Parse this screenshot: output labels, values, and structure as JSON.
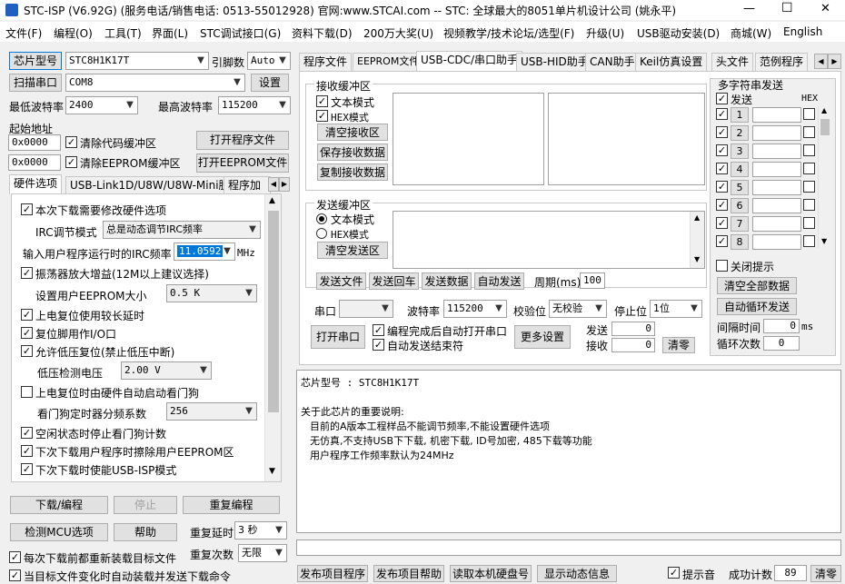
{
  "window": {
    "title": "STC-ISP (V6.92G) (服务电话/销售电话: 0513-55012928) 官网:www.STCAI.com  -- STC: 全球最大的8051单片机设计公司 (姚永平)"
  },
  "titlebar": {
    "minimize": "—",
    "maximize": "☐",
    "close": "✕"
  },
  "menu": [
    "文件(F)",
    "编程(O)",
    "工具(T)",
    "界面(L)",
    "STC调试接口(G)",
    "资料下载(D)",
    "200万大奖(U)",
    "视频教学/技术论坛/选型(F)",
    "升级(U)",
    "USB驱动安装(D)",
    "商城(W)",
    "English"
  ],
  "left": {
    "chip_btn": "芯片型号",
    "chip_value": "STC8H1K17T",
    "pins_label": "引脚数",
    "pins_value": "Auto",
    "scan_btn": "扫描串口",
    "port_value": "COM8",
    "settings_btn": "设置",
    "min_baud_label": "最低波特率",
    "min_baud_value": "2400",
    "max_baud_label": "最高波特率",
    "max_baud_value": "115200",
    "start_addr_label": "起始地址",
    "addr1": "0x0000",
    "clear_code": "清除代码缓冲区",
    "open_prog": "打开程序文件",
    "addr2": "0x0000",
    "clear_eeprom": "清除EEPROM缓冲区",
    "open_eeprom": "打开EEPROM文件",
    "tabs": [
      "硬件选项",
      "USB-Link1D/U8W/U8W-Mini脱机",
      "程序加"
    ],
    "options": {
      "opt1": "本次下载需要修改硬件选项",
      "irc_mode_label": "IRC调节模式",
      "irc_mode_value": "总是动态调节IRC频率",
      "irc_freq_label": "输入用户程序运行时的IRC频率",
      "irc_freq_value": "11.0592",
      "irc_unit": "MHz",
      "opt2": "振荡器放大增益(12M以上建议选择)",
      "eeprom_size_label": "设置用户EEPROM大小",
      "eeprom_size_value": "0.5 K",
      "opt3": "上电复位使用较长延时",
      "opt4": "复位脚用作I/O口",
      "opt5": "允许低压复位(禁止低压中断)",
      "lvd_label": "低压检测电压",
      "lvd_value": "2.00 V",
      "opt6": "上电复位时由硬件自动启动看门狗",
      "wdt_label": "看门狗定时器分频系数",
      "wdt_value": "256",
      "opt7": "空闲状态时停止看门狗计数",
      "opt8": "下次下载用户程序时擦除用户EEPROM区",
      "opt9": "下次下载时使能USB-ISP模式"
    },
    "download_btn": "下载/编程",
    "stop_btn": "停止",
    "reprog_btn": "重复编程",
    "detect_btn": "检测MCU选项",
    "help_btn": "帮助",
    "repeat_delay_label": "重复延时",
    "repeat_delay_value": "3 秒",
    "reload_each": "每次下载前都重新装载目标文件",
    "repeat_count_label": "重复次数",
    "repeat_count_value": "无限",
    "auto_reload": "当目标文件变化时自动装载并发送下载命令"
  },
  "right": {
    "tabs": [
      "程序文件",
      "EEPROM文件",
      "USB-CDC/串口助手",
      "USB-HID助手",
      "CAN助手",
      "Keil仿真设置",
      "头文件",
      "范例程序"
    ],
    "recv_group": "接收缓冲区",
    "recv_text": "文本模式",
    "recv_hex": "HEX模式",
    "clear_recv": "清空接收区",
    "save_recv": "保存接收数据",
    "copy_recv": "复制接收数据",
    "send_group": "发送缓冲区",
    "send_text": "文本模式",
    "send_hex": "HEX模式",
    "clear_send": "清空发送区",
    "send_file": "发送文件",
    "send_back": "发送回车",
    "send_data": "发送数据",
    "auto_send": "自动发送",
    "period_label": "周期(ms)",
    "period_value": "100",
    "port_label": "串口",
    "baud_label": "波特率",
    "baud_value": "115200",
    "parity_label": "校验位",
    "parity_value": "无校验",
    "stop_label": "停止位",
    "stop_value": "1位",
    "open_port": "打开串口",
    "auto_open": "编程完成后自动打开串口",
    "auto_end": "自动发送结束符",
    "more_settings": "更多设置",
    "sent_label": "发送",
    "sent_value": "0",
    "recv_label": "接收",
    "recv_value": "0",
    "clear_count": "清零",
    "multi": {
      "title": "多字符串发送",
      "send_col": "发送",
      "hex_col": "HEX",
      "rows": [
        "1",
        "2",
        "3",
        "4",
        "5",
        "6",
        "7",
        "8"
      ],
      "close_tip": "关闭提示",
      "clear_all": "清空全部数据",
      "auto_loop": "自动循环发送",
      "interval_label": "间隔时间",
      "interval_value": "0",
      "interval_unit": "ms",
      "loop_label": "循环次数",
      "loop_value": "0"
    }
  },
  "info": {
    "line1": "芯片型号 : STC8H1K17T",
    "line2": "关于此芯片的重要说明:",
    "line3": "目前的A版本工程样品不能调节频率,不能设置硬件选项",
    "line4": "无仿真,不支持USB下下载, 机密下载, ID号加密, 485下载等功能",
    "line5": "用户程序工作频率默认为24MHz"
  },
  "bottom": {
    "publish_prog": "发布项目程序",
    "publish_help": "发布项目帮助",
    "read_disk": "读取本机硬盘号",
    "show_formula": "显示动态信息",
    "beep": "提示音",
    "success_label": "成功计数",
    "success_value": "89",
    "clear": "清零"
  }
}
